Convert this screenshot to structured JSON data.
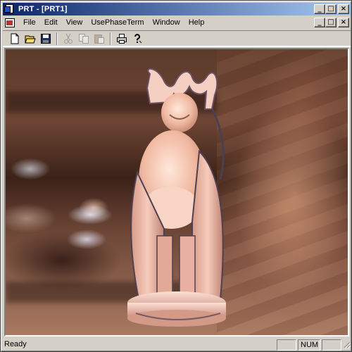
{
  "window": {
    "title": "PRT - [PRT1]"
  },
  "title_buttons": {
    "minimize": "_",
    "maximize": "□",
    "close": "×"
  },
  "menu": {
    "items": [
      {
        "id": "file",
        "label": "File"
      },
      {
        "id": "edit",
        "label": "Edit"
      },
      {
        "id": "view",
        "label": "View"
      },
      {
        "id": "usephaseterm",
        "label": "UsePhaseTerm"
      },
      {
        "id": "window",
        "label": "Window"
      },
      {
        "id": "help",
        "label": "Help"
      }
    ]
  },
  "toolbar": {
    "buttons": [
      {
        "icon": "new-document-icon",
        "enabled": true
      },
      {
        "icon": "open-folder-icon",
        "enabled": true
      },
      {
        "icon": "save-icon",
        "enabled": true
      },
      {
        "icon": "cut-icon",
        "enabled": false
      },
      {
        "icon": "copy-icon",
        "enabled": false
      },
      {
        "icon": "paste-icon",
        "enabled": false
      },
      {
        "icon": "print-icon",
        "enabled": true
      },
      {
        "icon": "help-icon",
        "enabled": true
      }
    ]
  },
  "statusbar": {
    "text": "Ready",
    "panes": {
      "cap": "",
      "num": "NUM",
      "scrl": ""
    }
  },
  "colors": {
    "titlebar_start": "#0a246a",
    "titlebar_end": "#a6caf0",
    "chrome": "#d4d0c8"
  }
}
